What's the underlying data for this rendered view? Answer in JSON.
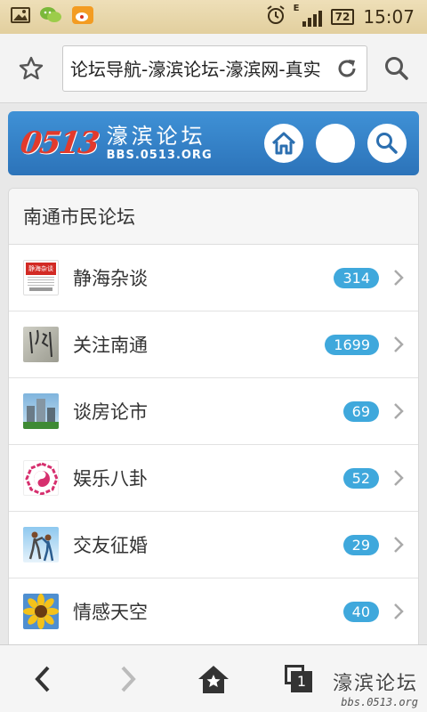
{
  "status_bar": {
    "time": "15:07",
    "battery": "72",
    "network_type": "E",
    "icons": [
      "image-notification-icon",
      "wechat-icon",
      "weibo-icon",
      "alarm-icon",
      "signal-icon",
      "battery-icon"
    ]
  },
  "browser": {
    "url_text": "论坛导航-濠滨论坛-濠滨网-真实",
    "icons": [
      "bookmark-star-icon",
      "reload-icon",
      "search-icon"
    ]
  },
  "site_header": {
    "logo_number": "0513",
    "logo_name": "濠滨论坛",
    "logo_url": "BBS.0513.ORG",
    "icons": [
      "home-icon",
      "blank-circle-button",
      "search-icon"
    ]
  },
  "forum_section": {
    "title": "南通市民论坛",
    "items": [
      {
        "label": "静海杂谈",
        "count": "314",
        "thumb": "jinghai-thumb"
      },
      {
        "label": "关注南通",
        "count": "1699",
        "thumb": "calligraphy-thumb"
      },
      {
        "label": "谈房论市",
        "count": "69",
        "thumb": "buildings-thumb"
      },
      {
        "label": "娱乐八卦",
        "count": "52",
        "thumb": "bagua-thumb"
      },
      {
        "label": "交友征婚",
        "count": "29",
        "thumb": "couple-thumb"
      },
      {
        "label": "情感天空",
        "count": "40",
        "thumb": "sunflower-thumb"
      }
    ]
  },
  "thumb_jinghai_text": "静海杂谈",
  "bottom_nav": {
    "icons": [
      "back-arrow-icon",
      "forward-arrow-icon",
      "home-icon",
      "tabs-icon"
    ],
    "tab_count": "1"
  },
  "watermark": {
    "name": "濠滨论坛",
    "url": "bbs.0513.org"
  },
  "colors": {
    "header_blue": "#2f7bc1",
    "badge_blue": "#3fa8dc",
    "status_bar": "#e8d7a9"
  }
}
